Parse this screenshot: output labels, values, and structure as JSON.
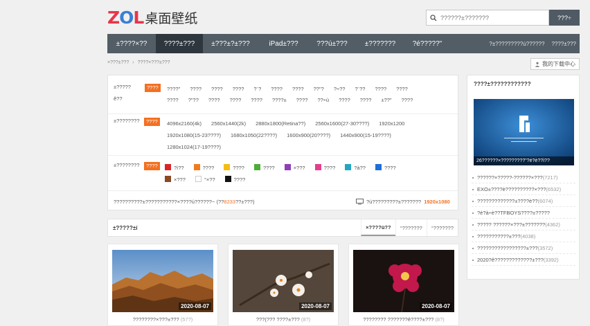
{
  "header": {
    "logo_zol": "ZOL",
    "logo_text": "桌面壁纸",
    "search_placeholder": "??????±???????",
    "search_button": "???÷"
  },
  "nav": {
    "items": [
      "±????×??",
      "????±???",
      "±???±?±???",
      "iPad±???",
      "???ú±???",
      "±???????",
      "?é?????\""
    ],
    "active_index": 1,
    "right_links": [
      "?±?????????ú??????",
      "????±???"
    ]
  },
  "breadcrumb": [
    "×???±???",
    "????×???±???"
  ],
  "download_center": "我的下载中心",
  "filters": {
    "category": {
      "label": "±?????",
      "label2": "ê??",
      "selected": "????",
      "options": [
        "????\"",
        "????",
        "????",
        "????",
        "?¨?",
        "????",
        "????",
        "??\"?",
        "?÷??",
        "?¨??",
        "????",
        "????",
        "????",
        "?\"??",
        "????",
        "????",
        "????",
        "????±",
        "????",
        "??÷ù",
        "????",
        "????",
        "±??\"",
        "????"
      ]
    },
    "resolution": {
      "label": "±????????",
      "selected": "????",
      "options": [
        "4096x2160(4k)",
        "2560x1440(2k)",
        "2880x1800(Retina??)",
        "2560x1600(27-30????)",
        "1920x1200",
        "1920x1080(15-23????)",
        "1680x1050(22????)",
        "1600x900(20????)",
        "1440x900(15-19????)",
        "1280x1024(17-19????)"
      ]
    },
    "color": {
      "label": "±????????",
      "selected": "????",
      "options": [
        {
          "name": "?ì??",
          "color": "#d9252a"
        },
        {
          "name": "????",
          "color": "#f07b1d"
        },
        {
          "name": "????",
          "color": "#f5bd13"
        },
        {
          "name": "????",
          "color": "#4cae37"
        },
        {
          "name": "×???",
          "color": "#8e3fb8"
        },
        {
          "name": "????",
          "color": "#e53e8e"
        },
        {
          "name": "?à??",
          "color": "#22a7c1"
        },
        {
          "name": "????",
          "color": "#1e6fd9"
        },
        {
          "name": "×???",
          "color": "#8a4a24"
        },
        {
          "name": "°×??",
          "color": "#ffffff"
        },
        {
          "name": "????",
          "color": "#111111"
        }
      ]
    },
    "summary_text": "??????????±???????????×????ú??????~",
    "summary_count_prefix": "(??",
    "summary_count": "8233",
    "summary_count_suffix": "??±???)",
    "screen_text": "?ú?????????±???????",
    "screen_resolution": "1920x1080"
  },
  "section": {
    "title": "±?????±í",
    "tabs": [
      "×????ü??",
      "°???????",
      "°???????"
    ],
    "active_tab": 0
  },
  "cards": [
    {
      "date": "2020-08-07",
      "caption": "????????×???±???",
      "count": "(57?)"
    },
    {
      "date": "2020-08-07",
      "caption": "???(??? ????±???",
      "count": "(8?)"
    },
    {
      "date": "2020-08-07",
      "caption": "???????? ???????ê????±???",
      "count": "(8?)"
    }
  ],
  "sidebar": {
    "title": "????±????????????",
    "banner_caption": "26??????×?????????\"?é?è??ì??",
    "items": [
      {
        "text": "??????×?????-??????×???",
        "count": "(7217)"
      },
      {
        "text": "EXO±????è??????????×???",
        "count": "(6532)"
      },
      {
        "text": "?????????????±????è??",
        "count": "(6074)"
      },
      {
        "text": "?é?à÷è??TFBOYS????±?????",
        "count": ""
      },
      {
        "text": "????? ??????×???±???????",
        "count": "(4362)"
      },
      {
        "text": "???????????±???",
        "count": "(4038)"
      },
      {
        "text": "?????????????????±???",
        "count": "(3572)"
      },
      {
        "text": "2020?ê?????????????±???",
        "count": "(3392)"
      }
    ]
  },
  "colors": {
    "nav_bg": "#535d66",
    "nav_active": "#2f373e",
    "accent": "#f37021"
  }
}
